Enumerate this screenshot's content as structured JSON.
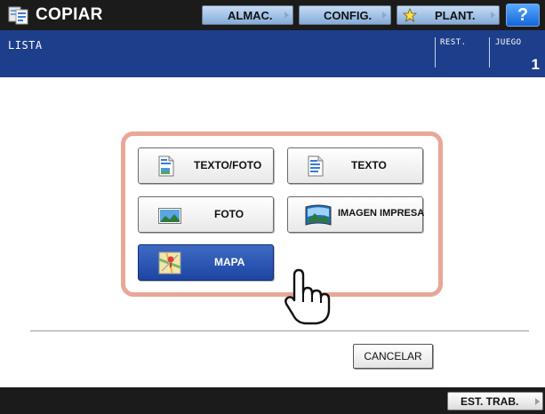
{
  "header": {
    "app_icon": "copier-icon",
    "title": "COPIAR",
    "buttons": [
      {
        "label": "ALMAC.",
        "icon": null
      },
      {
        "label": "CONFIG.",
        "icon": null
      },
      {
        "label": "PLANT.",
        "icon": "star-icon"
      }
    ],
    "help_label": "?"
  },
  "status": {
    "screen_name": "LISTA",
    "rest_label": "REST.",
    "juego_label": "JUEGO",
    "juego_count": "1"
  },
  "modes": [
    {
      "label": "TEXTO/FOTO",
      "icon": "text-photo-document-icon",
      "selected": false
    },
    {
      "label": "TEXTO",
      "icon": "text-document-icon",
      "selected": false
    },
    {
      "label": "FOTO",
      "icon": "photo-icon",
      "selected": false
    },
    {
      "label": "IMAGEN IMPRESA",
      "icon": "printed-image-icon",
      "selected": false
    },
    {
      "label": "MAPA",
      "icon": "map-icon",
      "selected": true
    }
  ],
  "cursor_icon": "pointing-hand-cursor-icon",
  "cancel_label": "CANCELAR",
  "footer": {
    "job_status_label": "EST. TRAB."
  },
  "colors": {
    "header_bg": "#1b1b1b",
    "status_bg": "#1d3e8a",
    "panel_border": "#e8a797",
    "selected_button": "#1d45a2",
    "help_button": "#1466d8"
  }
}
